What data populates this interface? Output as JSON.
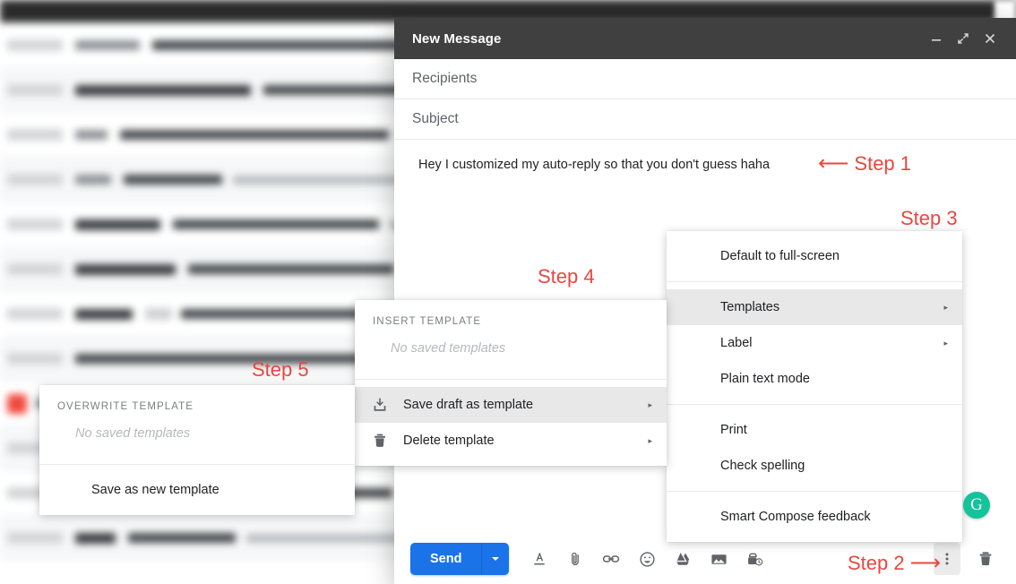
{
  "compose": {
    "title": "New Message",
    "window_buttons": [
      {
        "name": "minimize",
        "glyph": "minimize-icon"
      },
      {
        "name": "full-screen",
        "glyph": "expand-icon"
      },
      {
        "name": "close",
        "glyph": "close-icon"
      }
    ],
    "recipients_placeholder": "Recipients",
    "subject_placeholder": "Subject",
    "body_text": "Hey I customized my auto-reply so that you don't guess haha",
    "toolbar": {
      "send_label": "Send",
      "send_more_icon": "chevron-down-icon",
      "icons": [
        "format-text-icon",
        "attach-file-icon",
        "insert-link-icon",
        "insert-emoji-icon",
        "insert-drive-icon",
        "insert-photo-icon",
        "confidential-mode-icon"
      ],
      "more_options_icon": "more-vertical-icon",
      "discard_icon": "trash-icon"
    }
  },
  "menu_more_options": {
    "items": [
      {
        "label": "Default to full-screen",
        "submenu": false,
        "highlighted": false,
        "separator_after": true
      },
      {
        "label": "Templates",
        "submenu": true,
        "highlighted": true,
        "separator_after": false
      },
      {
        "label": "Label",
        "submenu": true,
        "highlighted": false,
        "separator_after": false
      },
      {
        "label": "Plain text mode",
        "submenu": false,
        "highlighted": false,
        "separator_after": true
      },
      {
        "label": "Print",
        "submenu": false,
        "highlighted": false,
        "separator_after": false
      },
      {
        "label": "Check spelling",
        "submenu": false,
        "highlighted": false,
        "separator_after": true
      },
      {
        "label": "Smart Compose feedback",
        "submenu": false,
        "highlighted": false,
        "separator_after": false
      }
    ]
  },
  "menu_templates": {
    "caption": "INSERT TEMPLATE",
    "empty_text": "No saved templates",
    "items": [
      {
        "label": "Save draft as template",
        "icon": "save-download-icon",
        "submenu": true,
        "highlighted": true
      },
      {
        "label": "Delete template",
        "icon": "trash-icon",
        "submenu": true,
        "highlighted": false
      }
    ]
  },
  "menu_overwrite": {
    "caption": "OVERWRITE TEMPLATE",
    "empty_text": "No saved templates",
    "items": [
      {
        "label": "Save as new template",
        "submenu": false,
        "highlighted": false
      }
    ]
  },
  "annotations": {
    "color": "#e8473f",
    "step1": {
      "arrow": "⟵",
      "label": "Step 1"
    },
    "step2": {
      "label": "Step 2",
      "arrow": "⟶"
    },
    "step3": {
      "label": "Step 3"
    },
    "step4": {
      "label": "Step 4"
    },
    "step5": {
      "label": "Step 5"
    }
  },
  "grammarly": {
    "glyph": "G",
    "color": "#15c39a"
  },
  "background": {
    "description": "blurred Gmail inbox message list",
    "rows": [
      {
        "tint": "dark",
        "star": false
      },
      {
        "tint": "plain",
        "star": false
      },
      {
        "tint": "alt",
        "star": false
      },
      {
        "tint": "plain",
        "star": false
      },
      {
        "tint": "alt",
        "star": false
      },
      {
        "tint": "plain",
        "star": false
      },
      {
        "tint": "alt",
        "star": false
      },
      {
        "tint": "plain",
        "star": false
      },
      {
        "tint": "alt",
        "star": true
      },
      {
        "tint": "plain",
        "star": false
      },
      {
        "tint": "alt",
        "star": false
      },
      {
        "tint": "plain",
        "star": false
      },
      {
        "tint": "alt",
        "star": false
      }
    ]
  }
}
